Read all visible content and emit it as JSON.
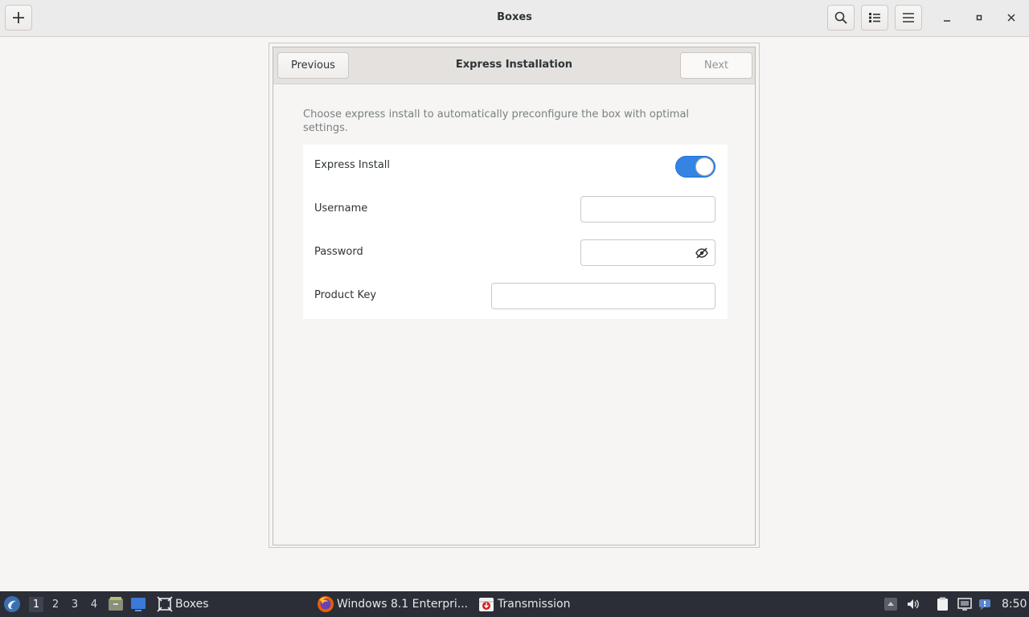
{
  "header": {
    "title": "Boxes",
    "add_icon": "plus-icon",
    "search_icon": "search-icon",
    "view_icon": "list-view-icon",
    "menu_icon": "hamburger-menu-icon",
    "minimize_icon": "minimize-icon",
    "maximize_icon": "maximize-icon",
    "close_icon": "close-icon"
  },
  "dialog": {
    "title": "Express Installation",
    "previous_label": "Previous",
    "next_label": "Next",
    "description": "Choose express install to automatically preconfigure the box with optimal settings.",
    "rows": {
      "express_install": {
        "label": "Express Install",
        "enabled": true
      },
      "username": {
        "label": "Username",
        "value": ""
      },
      "password": {
        "label": "Password",
        "value": ""
      },
      "product_key": {
        "label": "Product Key",
        "value": ""
      }
    }
  },
  "taskbar": {
    "workspaces": [
      "1",
      "2",
      "3",
      "4"
    ],
    "active_workspace": "1",
    "tasks": [
      {
        "label": "Boxes",
        "icon": "boxes-icon"
      },
      {
        "label": "Windows 8.1 Enterpri...",
        "icon": "firefox-icon"
      },
      {
        "label": "Transmission",
        "icon": "transmission-icon"
      }
    ],
    "clock": "8:50"
  },
  "colors": {
    "accent": "#3584e4",
    "taskbar_bg": "#2b2e37",
    "window_bg": "#f6f5f4"
  }
}
